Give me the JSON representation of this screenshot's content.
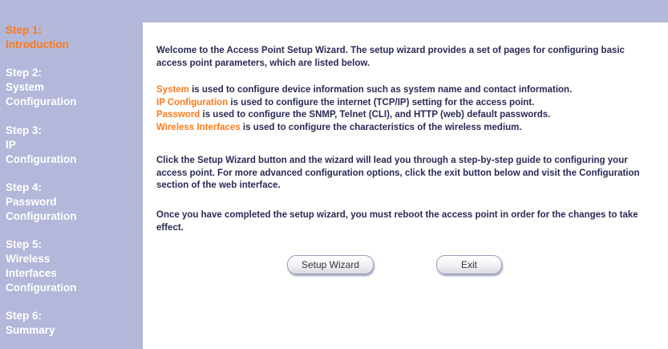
{
  "sidebar": {
    "steps": [
      {
        "label": "Step 1:",
        "lines": [
          "Introduction"
        ],
        "active": true
      },
      {
        "label": "Step 2:",
        "lines": [
          "System",
          "Configuration"
        ],
        "active": false
      },
      {
        "label": "Step 3:",
        "lines": [
          "IP",
          "Configuration"
        ],
        "active": false
      },
      {
        "label": "Step 4:",
        "lines": [
          "Password",
          "Configuration"
        ],
        "active": false
      },
      {
        "label": "Step 5:",
        "lines": [
          "Wireless",
          "Interfaces",
          "Configuration"
        ],
        "active": false
      },
      {
        "label": "Step 6:",
        "lines": [
          "Summary"
        ],
        "active": false
      }
    ]
  },
  "main": {
    "welcome": "Welcome to the Access Point Setup Wizard. The setup wizard provides a set of pages for configuring basic access point parameters, which are listed below.",
    "items": [
      {
        "term": "System",
        "desc": " is used to configure device information such as system name and contact information."
      },
      {
        "term": "IP Configuration",
        "desc": " is used to configure the internet (TCP/IP) setting for the access point."
      },
      {
        "term": "Password",
        "desc": " is used to configure the SNMP, Telnet (CLI), and HTTP (web) default passwords."
      },
      {
        "term": "Wireless Interfaces",
        "desc": " is used to configure the characteristics of the wireless medium."
      }
    ],
    "instructions": "Click the Setup Wizard button and the wizard will lead you through a step-by-step guide to configuring your access point. For more advanced configuration options, click the exit button below and visit the Configuration section of the web interface.",
    "reboot_note": "Once you have completed the setup wizard, you must reboot the access point in order for the changes to take effect.",
    "buttons": {
      "setup_wizard": "Setup Wizard",
      "exit": "Exit"
    }
  },
  "colors": {
    "sidebar_bg": "#b3b7d9",
    "active_step": "#ff7a1a",
    "highlight_term": "#ff7a1a",
    "body_text": "#2a2a55"
  }
}
